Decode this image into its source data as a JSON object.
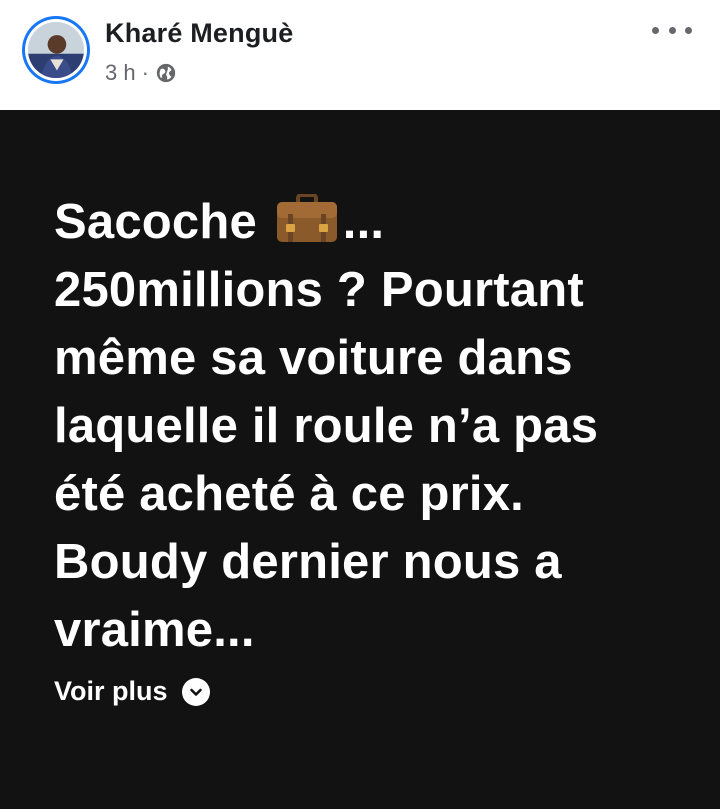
{
  "post": {
    "author": "Kharé Menguè",
    "time": "3 h",
    "separator": "·",
    "privacy_icon": "globe-icon",
    "text_line1_before": "Sacoche ",
    "text_line1_emoji": "briefcase-icon",
    "text_line1_after": "...",
    "text_rest": "250millions ? Pourtant\nmême sa voiture dans\nlaquelle il roule n’a pas\nété acheté à ce prix.\nBoudy dernier nous a\nvraime...",
    "see_more_label": "Voir plus"
  },
  "colors": {
    "background": "#121212",
    "accent": "#1877f2",
    "text_primary": "#1c1e21",
    "text_secondary": "#65676b"
  }
}
